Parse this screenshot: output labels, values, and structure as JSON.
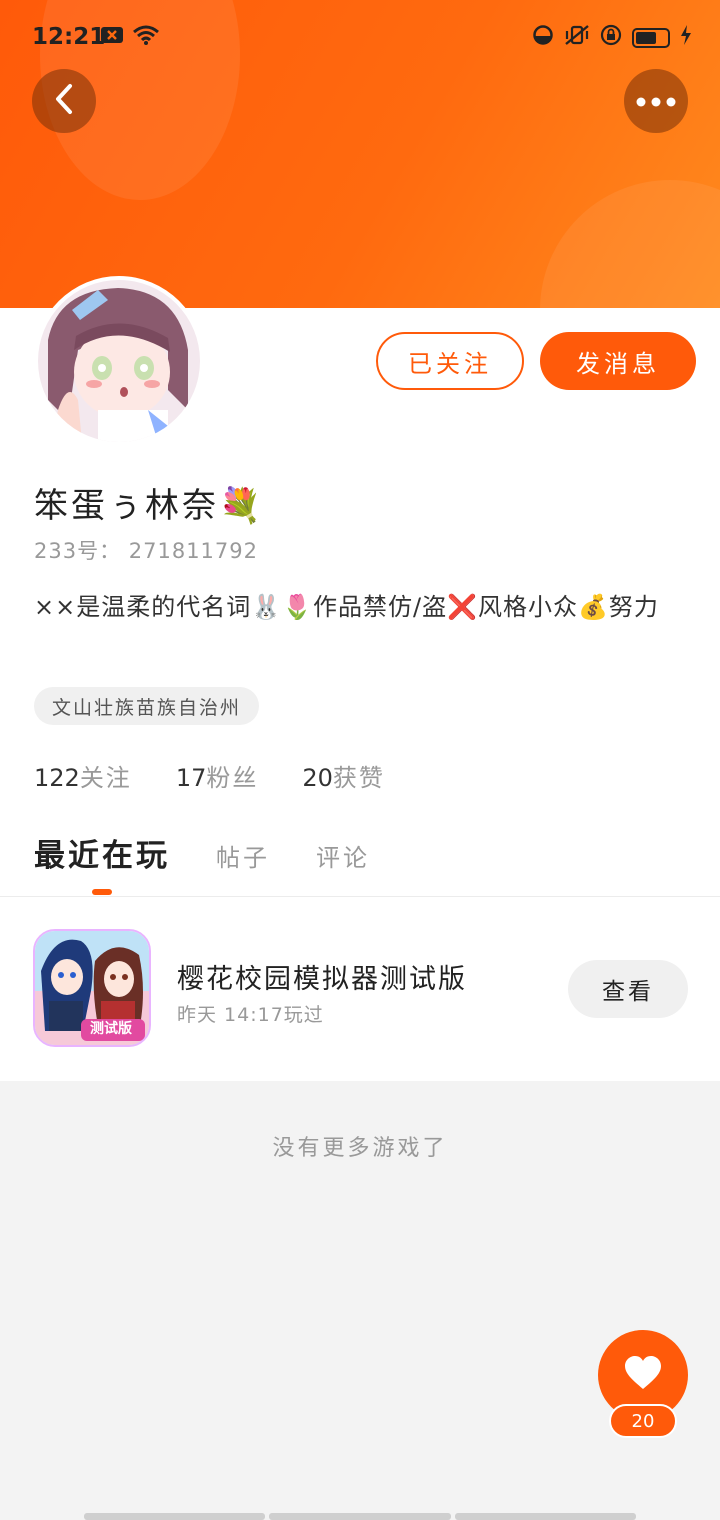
{
  "status_bar": {
    "time": "12:21",
    "left_icons": [
      "notification-x-icon",
      "wifi-icon"
    ],
    "right_icons": [
      "data-saver-icon",
      "mute-vibrate-icon",
      "rotation-lock-icon",
      "battery-icon",
      "charging-icon"
    ],
    "battery_level": 0.7
  },
  "header": {
    "back_icon": "chevron-left-icon",
    "more_icon": "more-dots-icon",
    "color": "#ff5a0a"
  },
  "profile": {
    "follow_label": "已关注",
    "message_label": "发消息",
    "username": "笨蛋ぅ林奈💐",
    "uid": "233号： 271811792",
    "bio": "××是温柔的代名词🐰🌷作品禁仿/盗❌风格小众💰努力",
    "location": "文山壮族苗族自治州",
    "stats": [
      {
        "num": "122",
        "label": "关注"
      },
      {
        "num": "17",
        "label": "粉丝"
      },
      {
        "num": "20",
        "label": "获赞"
      }
    ]
  },
  "tabs": [
    {
      "label": "最近在玩",
      "active": true
    },
    {
      "label": "帖子",
      "active": false
    },
    {
      "label": "评论",
      "active": false
    }
  ],
  "recent_game": {
    "title": "樱花校园模拟器测试版",
    "played": "昨天 14:17玩过",
    "view_label": "查看",
    "icon_badge": "测试版"
  },
  "no_more": "没有更多游戏了",
  "like": {
    "icon": "heart-icon",
    "count": "20"
  }
}
